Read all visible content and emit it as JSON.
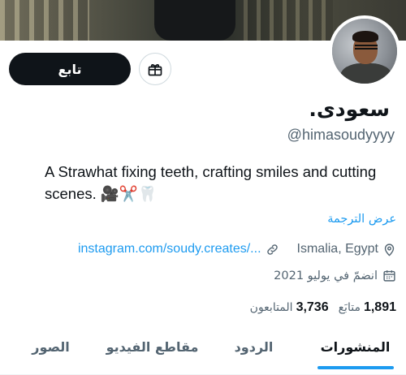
{
  "profile": {
    "display_name": "سعودى.",
    "handle": "@himasoudyyyy",
    "bio": "A Strawhat fixing teeth, crafting smiles and cutting scenes. 🎥✂️🦷",
    "translate_label": "عرض الترجمة",
    "location": "Ismalia, Egypt",
    "website": "instagram.com/soudy.creates/...",
    "joined": "انضمّ في يوليو 2021"
  },
  "actions": {
    "follow_label": "تابع",
    "gift_icon": "gift-icon"
  },
  "stats": {
    "following_count": "1,891",
    "following_label": "متابَع",
    "followers_count": "3,736",
    "followers_label": "المتابعون"
  },
  "tabs": [
    {
      "label": "المنشورات",
      "active": true
    },
    {
      "label": "الردود",
      "active": false
    },
    {
      "label": "مقاطع الفيديو",
      "active": false
    },
    {
      "label": "الصور",
      "active": false
    }
  ],
  "colors": {
    "accent": "#1d9bf0",
    "text": "#0f1419",
    "secondary": "#536471",
    "button": "#0f1419"
  }
}
